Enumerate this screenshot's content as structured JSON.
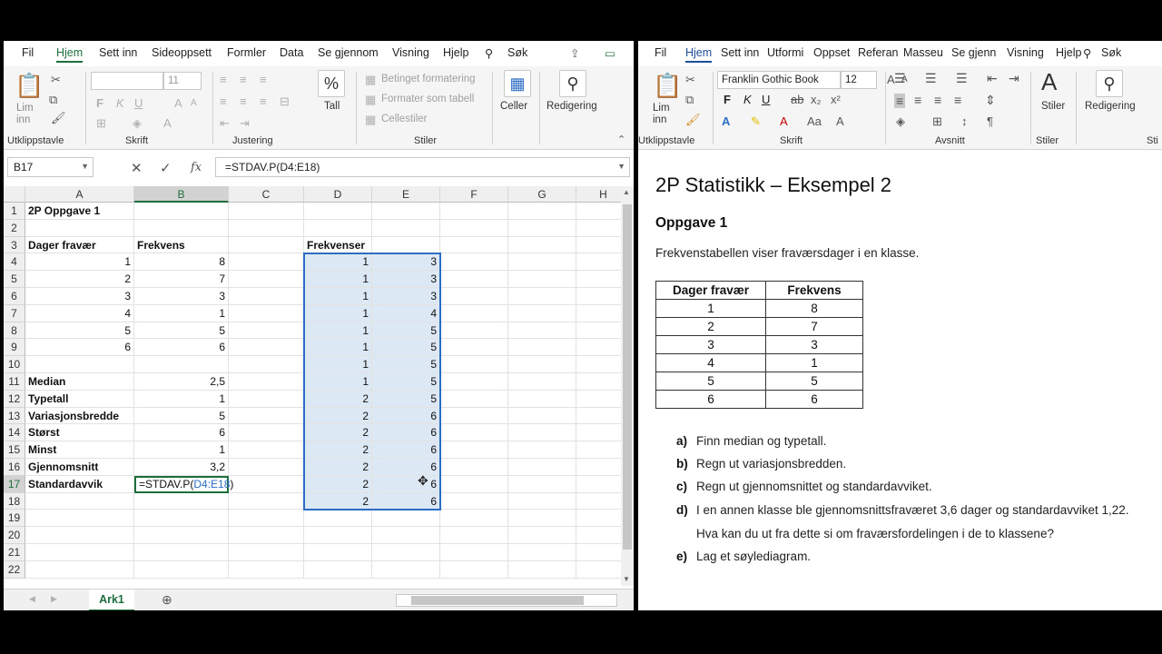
{
  "excel": {
    "tabs": [
      "Fil",
      "Hjem",
      "Sett inn",
      "Sideoppsett",
      "Formler",
      "Data",
      "Se gjennom",
      "Visning",
      "Hjelp",
      "Søk"
    ],
    "active_tab": "Hjem",
    "ribbon": {
      "paste_label": "Lim inn",
      "font_size": "11",
      "conditional": "Betinget formatering",
      "format_table": "Formater som tabell",
      "cell_styles": "Cellestiler",
      "percent_label": "Tall",
      "cells_label": "Celler",
      "editing_label": "Redigering",
      "groups": [
        "Utklippstavle",
        "Skrift",
        "Justering",
        "Stiler"
      ]
    },
    "name_box": "B17",
    "formula": "=STDAV.P(D4:E18)",
    "columns": [
      "A",
      "B",
      "C",
      "D",
      "E",
      "F",
      "G",
      "H"
    ],
    "rows": [
      "1",
      "2",
      "3",
      "4",
      "5",
      "6",
      "7",
      "8",
      "9",
      "10",
      "11",
      "12",
      "13",
      "14",
      "15",
      "16",
      "17",
      "18",
      "19",
      "20",
      "21",
      "22"
    ],
    "cells": {
      "A1": "2P Oppgave 1",
      "A3": "Dager fravær",
      "B3": "Frekvens",
      "D3": "Frekvenser",
      "A4": "1",
      "B4": "8",
      "A5": "2",
      "B5": "7",
      "A6": "3",
      "B6": "3",
      "A7": "4",
      "B7": "1",
      "A8": "5",
      "B8": "5",
      "A9": "6",
      "B9": "6",
      "A11": "Median",
      "B11": "2,5",
      "A12": "Typetall",
      "B12": "1",
      "A13": "Variasjonsbredde",
      "B13": "5",
      "A14": "Størst",
      "B14": "6",
      "A15": "Minst",
      "B15": "1",
      "A16": "Gjennomsnitt",
      "B16": "3,2",
      "A17": "Standardavvik",
      "B17_prefix": "=STDAV.P(",
      "B17_ref": "D4:E18",
      "B17_suffix": ")"
    },
    "d_values": [
      "1",
      "1",
      "1",
      "1",
      "1",
      "1",
      "1",
      "1",
      "2",
      "2",
      "2",
      "2",
      "2",
      "2",
      "2"
    ],
    "e_values": [
      "3",
      "3",
      "3",
      "4",
      "5",
      "5",
      "5",
      "5",
      "5",
      "6",
      "6",
      "6",
      "6",
      "6",
      "6"
    ],
    "sheet_tab": "Ark1",
    "accent": "#1e6e3e",
    "selection_color": "#2e6dc4"
  },
  "word": {
    "tabs": [
      "Fil",
      "Hjem",
      "Sett inn",
      "Utformi",
      "Oppset",
      "Referan",
      "Masseu",
      "Se gjenn",
      "Visning",
      "Hjelp",
      "Søk"
    ],
    "active_tab": "Hjem",
    "ribbon": {
      "paste_label": "Lim inn",
      "font_name": "Franklin Gothic Book",
      "font_size": "12",
      "styles_label": "Stiler",
      "editing_label": "Redigering",
      "groups": [
        "Utklippstavle",
        "Skrift",
        "Avsnitt",
        "Stiler",
        "Sti"
      ]
    },
    "title": "2P Statistikk – Eksempel 2",
    "subtitle": "Oppgave 1",
    "intro": "Frekvenstabellen viser fraværsdager i en klasse.",
    "table_headers": [
      "Dager fravær",
      "Frekvens"
    ],
    "table_rows": [
      [
        "1",
        "8"
      ],
      [
        "2",
        "7"
      ],
      [
        "3",
        "3"
      ],
      [
        "4",
        "1"
      ],
      [
        "5",
        "5"
      ],
      [
        "6",
        "6"
      ]
    ],
    "tasks": [
      {
        "letter": "a)",
        "text": "Finn median og typetall."
      },
      {
        "letter": "b)",
        "text": "Regn ut variasjonsbredden."
      },
      {
        "letter": "c)",
        "text": "Regn ut gjennomsnittet og standardavviket."
      },
      {
        "letter": "d)",
        "text": "I en annen klasse ble gjennomsnittsfraværet 3,6 dager og standardavviket 1,22."
      },
      {
        "letter": "",
        "text": "Hva kan du ut fra dette si om fraværsfordelingen i de to klassene?"
      },
      {
        "letter": "e)",
        "text": "Lag et søylediagram."
      }
    ],
    "accent": "#1f4e99"
  }
}
